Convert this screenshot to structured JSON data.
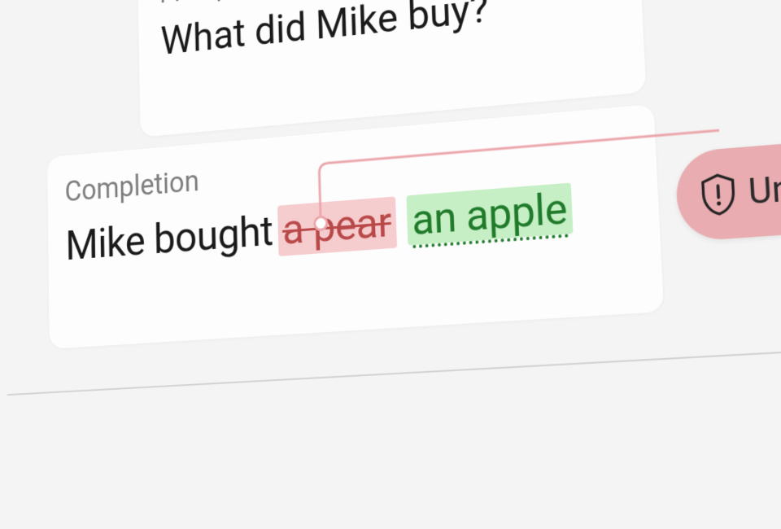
{
  "prompt": {
    "label": "Prompt",
    "text": "What did Mike buy?"
  },
  "completion": {
    "label": "Completion",
    "answer_prefix": "Mike bought ",
    "struck_text": "a pear",
    "corrected_text": "an apple"
  },
  "alert": {
    "label": "Ungroundedn"
  },
  "colors": {
    "strike_bg": "#f6cdcf",
    "strike_fg": "#b94848",
    "correct_bg": "#c6efc6",
    "correct_fg": "#1f7a2a",
    "alert_bg": "#e9adb1",
    "connector": "#eba6ab"
  }
}
